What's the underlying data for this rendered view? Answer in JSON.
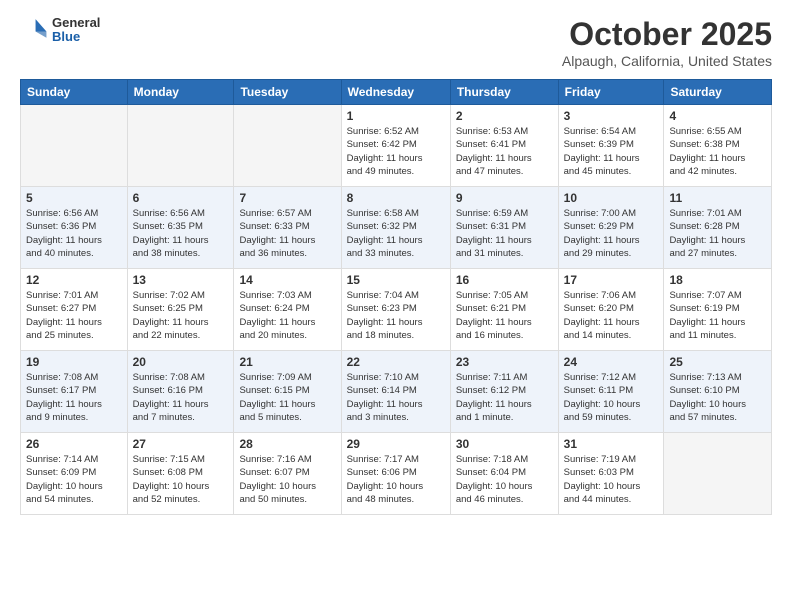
{
  "header": {
    "logo": {
      "general": "General",
      "blue": "Blue"
    },
    "title": "October 2025",
    "location": "Alpaugh, California, United States"
  },
  "weekdays": [
    "Sunday",
    "Monday",
    "Tuesday",
    "Wednesday",
    "Thursday",
    "Friday",
    "Saturday"
  ],
  "weeks": [
    [
      {
        "day": "",
        "info": ""
      },
      {
        "day": "",
        "info": ""
      },
      {
        "day": "",
        "info": ""
      },
      {
        "day": "1",
        "info": "Sunrise: 6:52 AM\nSunset: 6:42 PM\nDaylight: 11 hours\nand 49 minutes."
      },
      {
        "day": "2",
        "info": "Sunrise: 6:53 AM\nSunset: 6:41 PM\nDaylight: 11 hours\nand 47 minutes."
      },
      {
        "day": "3",
        "info": "Sunrise: 6:54 AM\nSunset: 6:39 PM\nDaylight: 11 hours\nand 45 minutes."
      },
      {
        "day": "4",
        "info": "Sunrise: 6:55 AM\nSunset: 6:38 PM\nDaylight: 11 hours\nand 42 minutes."
      }
    ],
    [
      {
        "day": "5",
        "info": "Sunrise: 6:56 AM\nSunset: 6:36 PM\nDaylight: 11 hours\nand 40 minutes."
      },
      {
        "day": "6",
        "info": "Sunrise: 6:56 AM\nSunset: 6:35 PM\nDaylight: 11 hours\nand 38 minutes."
      },
      {
        "day": "7",
        "info": "Sunrise: 6:57 AM\nSunset: 6:33 PM\nDaylight: 11 hours\nand 36 minutes."
      },
      {
        "day": "8",
        "info": "Sunrise: 6:58 AM\nSunset: 6:32 PM\nDaylight: 11 hours\nand 33 minutes."
      },
      {
        "day": "9",
        "info": "Sunrise: 6:59 AM\nSunset: 6:31 PM\nDaylight: 11 hours\nand 31 minutes."
      },
      {
        "day": "10",
        "info": "Sunrise: 7:00 AM\nSunset: 6:29 PM\nDaylight: 11 hours\nand 29 minutes."
      },
      {
        "day": "11",
        "info": "Sunrise: 7:01 AM\nSunset: 6:28 PM\nDaylight: 11 hours\nand 27 minutes."
      }
    ],
    [
      {
        "day": "12",
        "info": "Sunrise: 7:01 AM\nSunset: 6:27 PM\nDaylight: 11 hours\nand 25 minutes."
      },
      {
        "day": "13",
        "info": "Sunrise: 7:02 AM\nSunset: 6:25 PM\nDaylight: 11 hours\nand 22 minutes."
      },
      {
        "day": "14",
        "info": "Sunrise: 7:03 AM\nSunset: 6:24 PM\nDaylight: 11 hours\nand 20 minutes."
      },
      {
        "day": "15",
        "info": "Sunrise: 7:04 AM\nSunset: 6:23 PM\nDaylight: 11 hours\nand 18 minutes."
      },
      {
        "day": "16",
        "info": "Sunrise: 7:05 AM\nSunset: 6:21 PM\nDaylight: 11 hours\nand 16 minutes."
      },
      {
        "day": "17",
        "info": "Sunrise: 7:06 AM\nSunset: 6:20 PM\nDaylight: 11 hours\nand 14 minutes."
      },
      {
        "day": "18",
        "info": "Sunrise: 7:07 AM\nSunset: 6:19 PM\nDaylight: 11 hours\nand 11 minutes."
      }
    ],
    [
      {
        "day": "19",
        "info": "Sunrise: 7:08 AM\nSunset: 6:17 PM\nDaylight: 11 hours\nand 9 minutes."
      },
      {
        "day": "20",
        "info": "Sunrise: 7:08 AM\nSunset: 6:16 PM\nDaylight: 11 hours\nand 7 minutes."
      },
      {
        "day": "21",
        "info": "Sunrise: 7:09 AM\nSunset: 6:15 PM\nDaylight: 11 hours\nand 5 minutes."
      },
      {
        "day": "22",
        "info": "Sunrise: 7:10 AM\nSunset: 6:14 PM\nDaylight: 11 hours\nand 3 minutes."
      },
      {
        "day": "23",
        "info": "Sunrise: 7:11 AM\nSunset: 6:12 PM\nDaylight: 11 hours\nand 1 minute."
      },
      {
        "day": "24",
        "info": "Sunrise: 7:12 AM\nSunset: 6:11 PM\nDaylight: 10 hours\nand 59 minutes."
      },
      {
        "day": "25",
        "info": "Sunrise: 7:13 AM\nSunset: 6:10 PM\nDaylight: 10 hours\nand 57 minutes."
      }
    ],
    [
      {
        "day": "26",
        "info": "Sunrise: 7:14 AM\nSunset: 6:09 PM\nDaylight: 10 hours\nand 54 minutes."
      },
      {
        "day": "27",
        "info": "Sunrise: 7:15 AM\nSunset: 6:08 PM\nDaylight: 10 hours\nand 52 minutes."
      },
      {
        "day": "28",
        "info": "Sunrise: 7:16 AM\nSunset: 6:07 PM\nDaylight: 10 hours\nand 50 minutes."
      },
      {
        "day": "29",
        "info": "Sunrise: 7:17 AM\nSunset: 6:06 PM\nDaylight: 10 hours\nand 48 minutes."
      },
      {
        "day": "30",
        "info": "Sunrise: 7:18 AM\nSunset: 6:04 PM\nDaylight: 10 hours\nand 46 minutes."
      },
      {
        "day": "31",
        "info": "Sunrise: 7:19 AM\nSunset: 6:03 PM\nDaylight: 10 hours\nand 44 minutes."
      },
      {
        "day": "",
        "info": ""
      }
    ]
  ]
}
